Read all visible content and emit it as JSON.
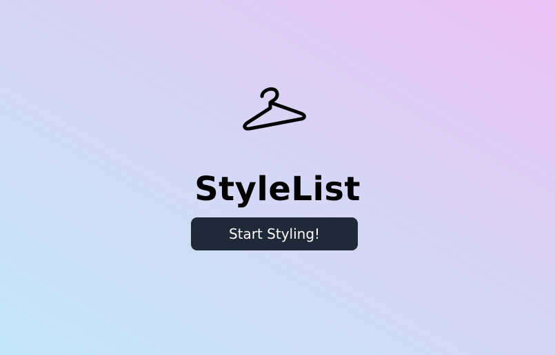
{
  "app": {
    "title": "StyleList",
    "logo_icon": "clothes-hanger-icon"
  },
  "cta": {
    "label": "Start Styling!"
  },
  "colors": {
    "background_gradient": [
      "#c2e6f8",
      "#d4d8f5",
      "#ddcff5",
      "#ecc1f5"
    ],
    "button_background": "#1f2937",
    "button_text": "#ffffff",
    "title_text": "#000000"
  }
}
